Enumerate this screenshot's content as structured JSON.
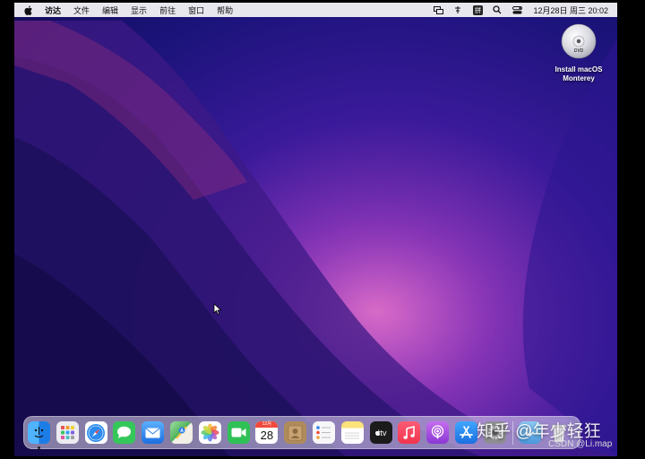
{
  "menubar": {
    "apple_icon": "apple-logo-icon",
    "items": [
      "访达",
      "文件",
      "编辑",
      "显示",
      "前往",
      "窗口",
      "帮助"
    ],
    "status_icons": [
      "screen-mirroring-icon",
      "network-icon"
    ],
    "input_method": "拼",
    "search_icon": "magnifier-icon",
    "control_center_icon": "control-center-icon",
    "clock": "12月28日 周三  20:02"
  },
  "desktop": {
    "disc_text": "DVD",
    "icon_label": "Install macOS\nMonterey"
  },
  "dock": {
    "calendar_month": "12月",
    "calendar_day": "28",
    "tv_label": "tv",
    "apps": [
      {
        "name": "finder",
        "color": "#2b8cf0"
      },
      {
        "name": "launchpad",
        "color": "#e9e9ee"
      },
      {
        "name": "safari",
        "color": "#1f7fe8"
      },
      {
        "name": "messages",
        "color": "#34c759"
      },
      {
        "name": "mail",
        "color": "#2e7ef0"
      },
      {
        "name": "maps",
        "color": "#4cb05a"
      },
      {
        "name": "photos",
        "color": "#ffffff"
      },
      {
        "name": "facetime",
        "color": "#2fc156"
      },
      {
        "name": "calendar",
        "color": "#ffffff"
      },
      {
        "name": "contacts",
        "color": "#b08b5b"
      },
      {
        "name": "reminders",
        "color": "#f4f4f6"
      },
      {
        "name": "notes",
        "color": "#fbe27a"
      },
      {
        "name": "apple-tv",
        "color": "#1b1b1b"
      },
      {
        "name": "music",
        "color": "#f5405c"
      },
      {
        "name": "podcasts",
        "color": "#9b4be0"
      },
      {
        "name": "app-store",
        "color": "#2b84f0"
      },
      {
        "name": "system-preferences",
        "color": "#8e8e93"
      },
      {
        "name": "downloads",
        "color": "#5aa9e6"
      },
      {
        "name": "trash",
        "color": "#c9c9cf"
      }
    ]
  },
  "watermark": {
    "main": "知乎 @年少轻狂",
    "sub": "CSDN @Li.map"
  }
}
